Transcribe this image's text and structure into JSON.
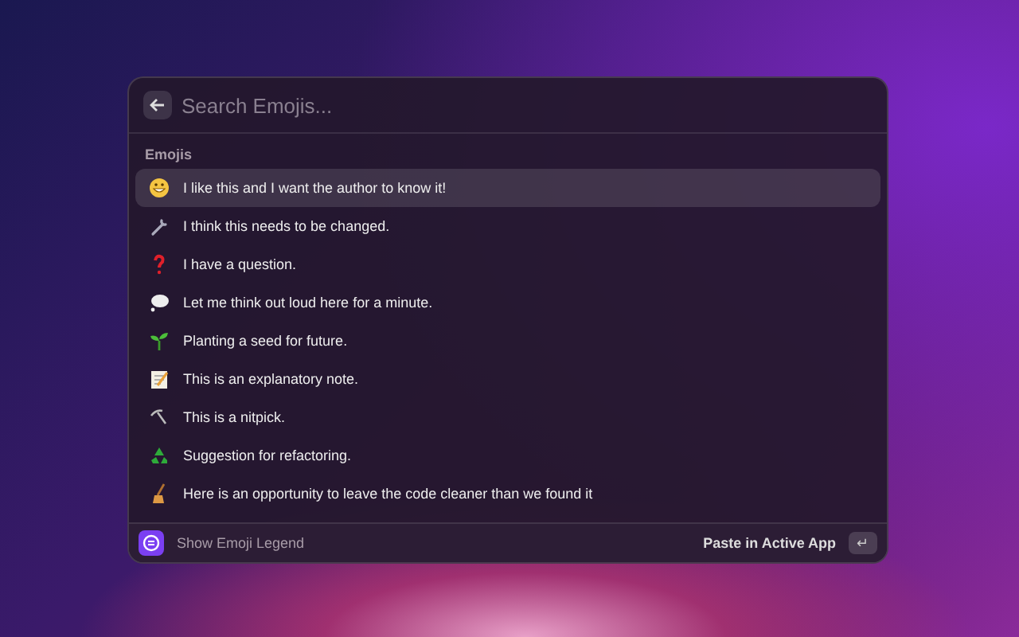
{
  "search": {
    "placeholder": "Search Emojis..."
  },
  "section": "Emojis",
  "items": [
    {
      "label": "I like this and I want the author to know it!",
      "selected": true
    },
    {
      "label": "I think this needs to be changed.",
      "selected": false
    },
    {
      "label": "I have a question.",
      "selected": false
    },
    {
      "label": "Let me think out loud here for a minute.",
      "selected": false
    },
    {
      "label": "Planting a seed for future.",
      "selected": false
    },
    {
      "label": "This is an explanatory note.",
      "selected": false
    },
    {
      "label": "This is a nitpick.",
      "selected": false
    },
    {
      "label": "Suggestion for refactoring.",
      "selected": false
    },
    {
      "label": "Here is an opportunity to leave the code cleaner than we found it",
      "selected": false
    }
  ],
  "footer": {
    "legend": "Show Emoji Legend",
    "action": "Paste in Active App",
    "key": "↵"
  }
}
